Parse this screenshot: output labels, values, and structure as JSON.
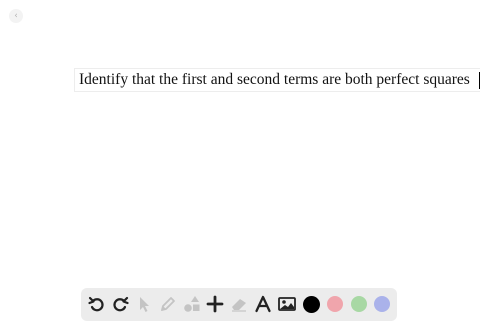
{
  "nav": {
    "back_icon": "chevron-left-icon",
    "back_glyph": "‹"
  },
  "canvas": {
    "text": "Identify that the first and second terms are both perfect squares"
  },
  "toolbar": {
    "tools": [
      "undo-icon",
      "redo-icon",
      "pointer-icon",
      "pen-icon",
      "shapes-icon",
      "add-icon",
      "eraser-icon",
      "text-icon",
      "image-icon"
    ],
    "colors": [
      "#000000",
      "#f0a5ac",
      "#a8d8a4",
      "#aab2ea"
    ]
  }
}
